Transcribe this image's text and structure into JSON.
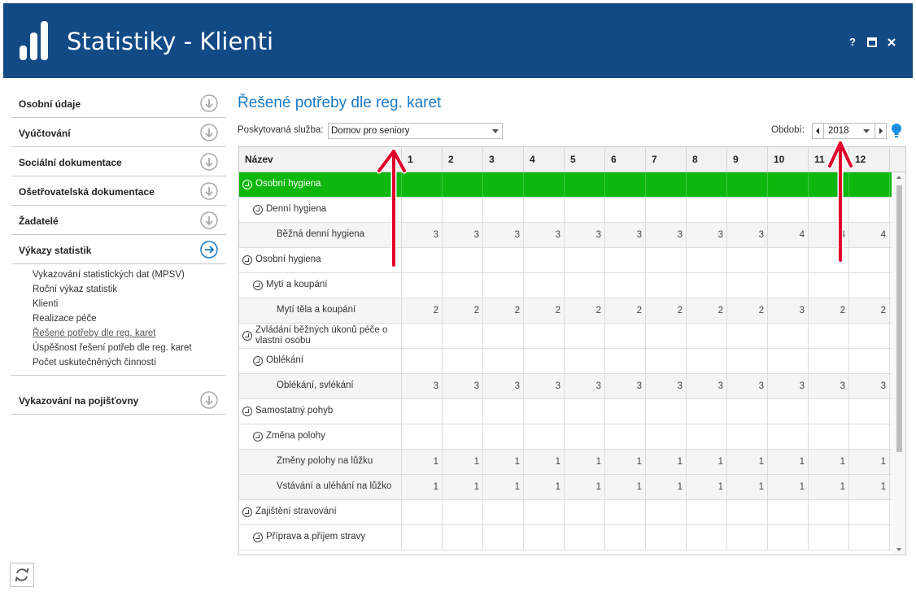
{
  "window": {
    "title": "Statistiky - Klienti",
    "controls": {
      "help": "?",
      "maximize": "▪",
      "close": "✕"
    },
    "bg_color": "#124a86"
  },
  "sidebar": {
    "items": [
      {
        "label": "Osobní údaje",
        "icon": "circle-down-arrow-icon"
      },
      {
        "label": "Vyúčtování",
        "icon": "circle-down-arrow-icon"
      },
      {
        "label": "Sociální dokumentace",
        "icon": "circle-down-arrow-icon"
      },
      {
        "label": "Ošetřovatelská dokumentace",
        "icon": "circle-down-arrow-icon"
      },
      {
        "label": "Žadatelé",
        "icon": "circle-down-arrow-icon"
      },
      {
        "label": "Výkazy statistik",
        "icon": "circle-right-arrow-icon",
        "expanded": true
      }
    ],
    "sub_items": [
      "Vykazování statistických dat (MPSV)",
      "Roční výkaz statistik",
      "Klienti",
      "Realizace péče",
      "Řešené potřeby dle reg. karet",
      "Úspěšnost řešení potřeb dle reg. karet",
      "Počet uskutečněných činností"
    ],
    "active_sub_item": "Řešené potřeby dle reg. karet",
    "last_item": {
      "label": "Vykazování na pojišťovny",
      "icon": "circle-down-arrow-icon"
    },
    "refresh_icon": "refresh-icon"
  },
  "main": {
    "title": "Řešené potřeby dle reg. karet",
    "service": {
      "label": "Poskytovaná služba:",
      "value": "Domov pro seniory"
    },
    "period": {
      "label": "Období:",
      "value": "2018"
    },
    "hint_icon": "lightbulb-icon"
  },
  "grid": {
    "header": {
      "name": "Název",
      "months": [
        "1",
        "2",
        "3",
        "4",
        "5",
        "6",
        "7",
        "8",
        "9",
        "10",
        "11",
        "12"
      ]
    },
    "rows": [
      {
        "name": "Osobní hygiena",
        "level": 0,
        "expander": true,
        "selected": true,
        "values": [
          "",
          "",
          "",
          "",
          "",
          "",
          "",
          "",
          "",
          "",
          "",
          ""
        ]
      },
      {
        "name": "Denní hygiena",
        "level": 1,
        "expander": true,
        "values": [
          "",
          "",
          "",
          "",
          "",
          "",
          "",
          "",
          "",
          "",
          "",
          ""
        ]
      },
      {
        "name": "Běžná denní hygiena",
        "level": 2,
        "expander": false,
        "values": [
          "3",
          "3",
          "3",
          "3",
          "3",
          "3",
          "3",
          "3",
          "3",
          "4",
          "4",
          "4"
        ]
      },
      {
        "name": "Osobní hygiena",
        "level": 0,
        "expander": true,
        "values": [
          "",
          "",
          "",
          "",
          "",
          "",
          "",
          "",
          "",
          "",
          "",
          ""
        ]
      },
      {
        "name": "Mytí a koupání",
        "level": 1,
        "expander": true,
        "values": [
          "",
          "",
          "",
          "",
          "",
          "",
          "",
          "",
          "",
          "",
          "",
          ""
        ]
      },
      {
        "name": "Mytí těla a koupání",
        "level": 2,
        "expander": false,
        "values": [
          "2",
          "2",
          "2",
          "2",
          "2",
          "2",
          "2",
          "2",
          "2",
          "3",
          "2",
          "2"
        ]
      },
      {
        "name": "Zvládání běžných úkonů péče o vlastní osobu",
        "level": 0,
        "expander": true,
        "wrap": true,
        "values": [
          "",
          "",
          "",
          "",
          "",
          "",
          "",
          "",
          "",
          "",
          "",
          ""
        ]
      },
      {
        "name": "Oblékání",
        "level": 1,
        "expander": true,
        "values": [
          "",
          "",
          "",
          "",
          "",
          "",
          "",
          "",
          "",
          "",
          "",
          ""
        ]
      },
      {
        "name": "Oblékání, svlékání",
        "level": 2,
        "expander": false,
        "values": [
          "3",
          "3",
          "3",
          "3",
          "3",
          "3",
          "3",
          "3",
          "3",
          "3",
          "3",
          "3"
        ]
      },
      {
        "name": "Samostatný pohyb",
        "level": 0,
        "expander": true,
        "values": [
          "",
          "",
          "",
          "",
          "",
          "",
          "",
          "",
          "",
          "",
          "",
          ""
        ]
      },
      {
        "name": "Změna polohy",
        "level": 1,
        "expander": true,
        "values": [
          "",
          "",
          "",
          "",
          "",
          "",
          "",
          "",
          "",
          "",
          "",
          ""
        ]
      },
      {
        "name": "Změny polohy na lůžku",
        "level": 2,
        "expander": false,
        "values": [
          "1",
          "1",
          "1",
          "1",
          "1",
          "1",
          "1",
          "1",
          "1",
          "1",
          "1",
          "1"
        ]
      },
      {
        "name": "Vstávání a uléhání na lůžko",
        "level": 2,
        "expander": false,
        "values": [
          "1",
          "1",
          "1",
          "1",
          "1",
          "1",
          "1",
          "1",
          "1",
          "1",
          "1",
          "1"
        ]
      },
      {
        "name": "Zajištění stravování",
        "level": 0,
        "expander": true,
        "values": [
          "",
          "",
          "",
          "",
          "",
          "",
          "",
          "",
          "",
          "",
          "",
          ""
        ]
      },
      {
        "name": "Příprava a příjem stravy",
        "level": 1,
        "expander": true,
        "values": [
          "",
          "",
          "",
          "",
          "",
          "",
          "",
          "",
          "",
          "",
          "",
          ""
        ]
      }
    ],
    "selected_color": "#0db70d",
    "alt_row_color": "#f5f5f5"
  },
  "annotations": {
    "arrow_color": "#e0002a"
  }
}
